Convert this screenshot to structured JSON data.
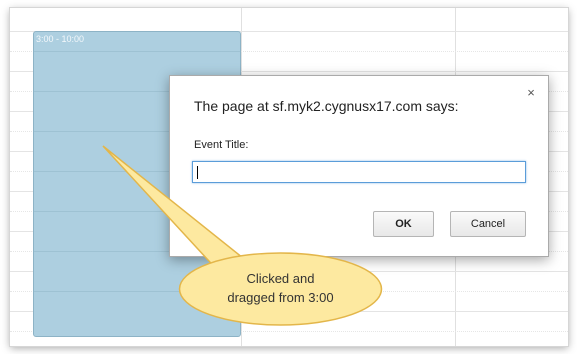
{
  "calendar": {
    "event": {
      "time_label": "3:00 - 10:00",
      "color": "#adcfe0",
      "border_color": "#8db3c6"
    }
  },
  "dialog": {
    "title": "The page at sf.myk2.cygnusx17.com says:",
    "close_icon": "close-icon",
    "close_glyph": "×",
    "field_label": "Event Title:",
    "field_value": "",
    "ok_label": "OK",
    "cancel_label": "Cancel"
  },
  "callout": {
    "line1": "Clicked and",
    "line2": "dragged from 3:00",
    "fill_color": "#fde9a0",
    "stroke_color": "#e3b64a"
  }
}
